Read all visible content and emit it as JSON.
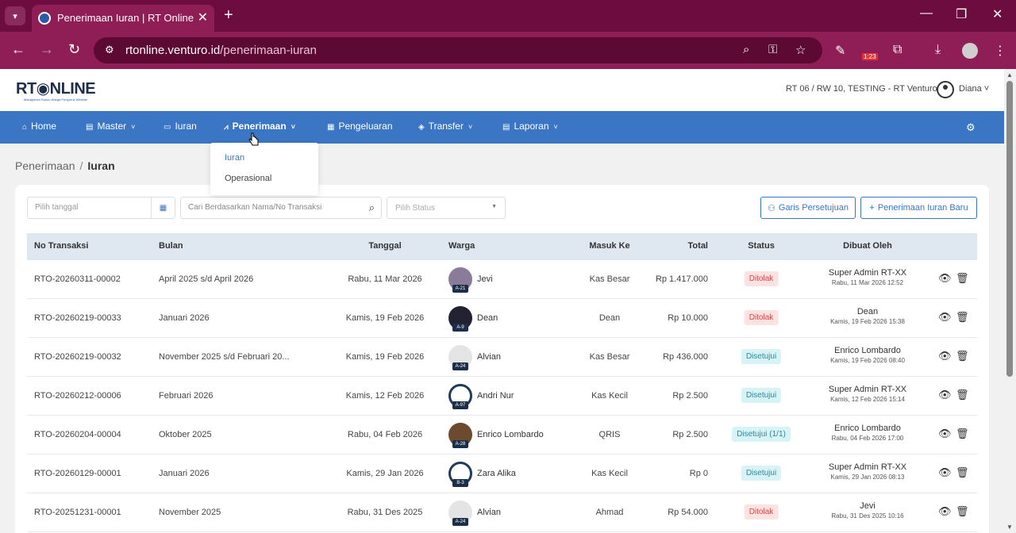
{
  "browser": {
    "tab_title": "Penerimaan Iuran | RT Online",
    "url_host": "rtonline.venturo.id",
    "url_path": "/penerimaan-iuran",
    "ext_badge": "1:23"
  },
  "header": {
    "logo_main": "RT",
    "logo_rest": "NLINE",
    "logo_sub": "Manajemen Rukun Warga Pengurus Website",
    "org": "RT 06 / RW 10, TESTING - RT Venturo",
    "user": "Diana"
  },
  "nav": {
    "home": "Home",
    "master": "Master",
    "iuran": "Iuran",
    "penerimaan": "Penerimaan",
    "pengeluaran": "Pengeluaran",
    "transfer": "Transfer",
    "laporan": "Laporan"
  },
  "dropdown": {
    "item1": "Iuran",
    "item2": "Operasional"
  },
  "breadcrumb": {
    "parent": "Penerimaan",
    "current": "Iuran"
  },
  "filters": {
    "date_placeholder": "Pilih tanggal",
    "search_placeholder": "Cari Berdasarkan Nama/No Transaksi",
    "status_placeholder": "Pilih Status",
    "btn_garis": "Garis Persetujuan",
    "btn_baru": "Penerimaan Iuran Baru"
  },
  "table": {
    "headers": {
      "no": "No Transaksi",
      "bulan": "Bulan",
      "tanggal": "Tanggal",
      "warga": "Warga",
      "masuk": "Masuk Ke",
      "total": "Total",
      "status": "Status",
      "dibuat": "Dibuat Oleh"
    },
    "rows": [
      {
        "no": "RTO-20260311-00002",
        "bulan": "April 2025 s/d April 2026",
        "tanggal": "Rabu, 11 Mar 2026",
        "warga": "Jevi",
        "unit": "A-21",
        "masuk": "Kas Besar",
        "total": "Rp 1.417.000",
        "status": "Ditolak",
        "creator": "Super Admin RT-XX",
        "created": "Rabu, 11 Mar 2026 12:52"
      },
      {
        "no": "RTO-20260219-00033",
        "bulan": "Januari 2026",
        "tanggal": "Kamis, 19 Feb 2026",
        "warga": "Dean",
        "unit": "A-9",
        "masuk": "Dean",
        "total": "Rp 10.000",
        "status": "Ditolak",
        "creator": "Dean",
        "created": "Kamis, 19 Feb 2026 15:38"
      },
      {
        "no": "RTO-20260219-00032",
        "bulan": "November 2025 s/d Februari 20...",
        "tanggal": "Kamis, 19 Feb 2026",
        "warga": "Alvian",
        "unit": "A-24",
        "masuk": "Kas Besar",
        "total": "Rp 436.000",
        "status": "Disetujui",
        "creator": "Enrico Lombardo",
        "created": "Kamis, 19 Feb 2026 08:40"
      },
      {
        "no": "RTO-20260212-00006",
        "bulan": "Februari 2026",
        "tanggal": "Kamis, 12 Feb 2026",
        "warga": "Andri Nur",
        "unit": "A-97",
        "masuk": "Kas Kecil",
        "total": "Rp 2.500",
        "status": "Disetujui",
        "creator": "Super Admin RT-XX",
        "created": "Kamis, 12 Feb 2026 15:14"
      },
      {
        "no": "RTO-20260204-00004",
        "bulan": "Oktober 2025",
        "tanggal": "Rabu, 04 Feb 2026",
        "warga": "Enrico Lombardo",
        "unit": "A-28",
        "masuk": "QRIS",
        "total": "Rp 2.500",
        "status": "Disetujui (1/1)",
        "creator": "Enrico Lombardo",
        "created": "Rabu, 04 Feb 2026 17:00"
      },
      {
        "no": "RTO-20260129-00001",
        "bulan": "Januari 2026",
        "tanggal": "Kamis, 29 Jan 2026",
        "warga": "Zara Alika",
        "unit": "B-3",
        "masuk": "Kas Kecil",
        "total": "Rp 0",
        "status": "Disetujui",
        "creator": "Super Admin RT-XX",
        "created": "Kamis, 29 Jan 2026 08:13"
      },
      {
        "no": "RTO-20251231-00001",
        "bulan": "November 2025",
        "tanggal": "Rabu, 31 Des 2025",
        "warga": "Alvian",
        "unit": "A-24",
        "masuk": "Ahmad",
        "total": "Rp 54.000",
        "status": "Ditolak",
        "creator": "Jevi",
        "created": "Rabu, 31 Des 2025 10:16"
      }
    ]
  },
  "colors": {
    "chrome": "#8e1e55",
    "nav": "#3a76c4",
    "rejected": "#d64545",
    "approved": "#2a8aa0"
  }
}
